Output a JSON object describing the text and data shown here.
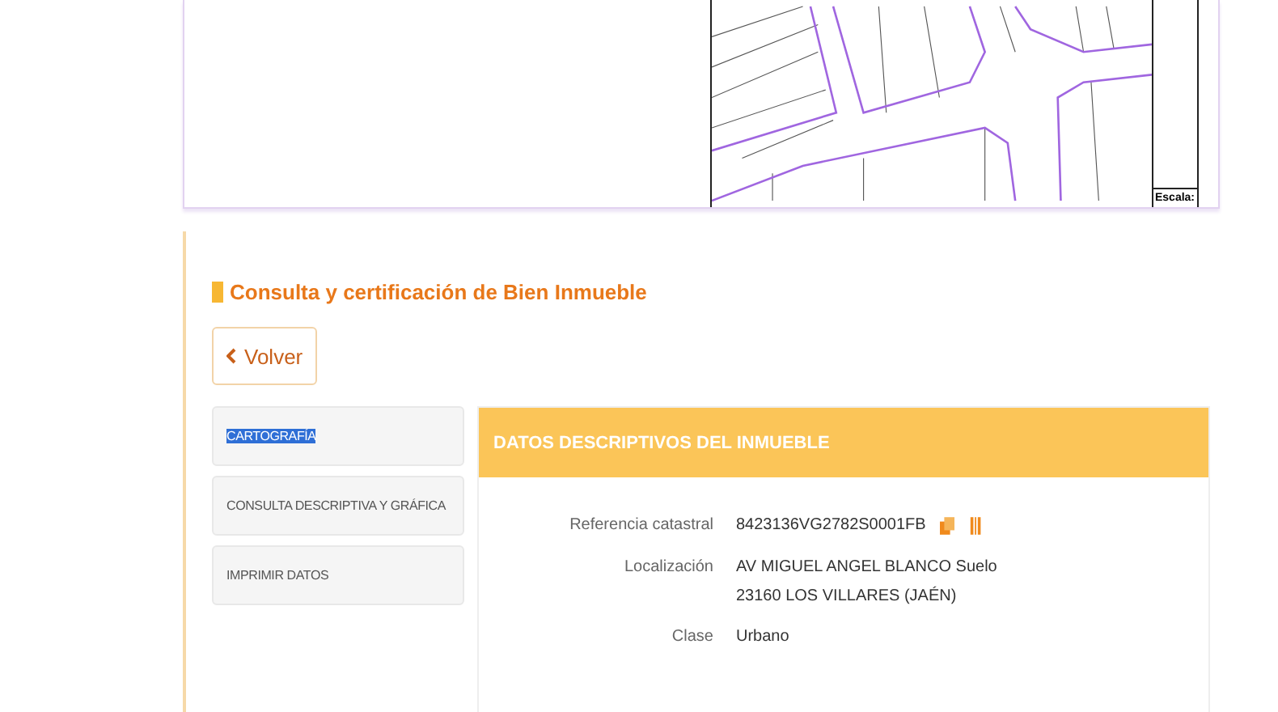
{
  "map": {
    "scale_label": "Escala:"
  },
  "page": {
    "title": "Consulta y certificación de Bien Inmueble",
    "back_button": "Volver"
  },
  "sidebar": {
    "items": [
      {
        "label": "CARTOGRAFÍA",
        "selected": true
      },
      {
        "label": "CONSULTA DESCRIPTIVA Y GRÁFICA",
        "selected": false
      },
      {
        "label": "IMPRIMIR DATOS",
        "selected": false
      }
    ]
  },
  "panel": {
    "title": "DATOS DESCRIPTIVOS DEL INMUEBLE",
    "fields": [
      {
        "label": "Referencia catastral",
        "lines": [
          "8423136VG2782S0001FB"
        ],
        "kind": "reference"
      },
      {
        "label": "Localización",
        "lines": [
          "AV MIGUEL ANGEL BLANCO Suelo",
          "23160 LOS VILLARES (JAÉN)"
        ],
        "kind": "text"
      },
      {
        "label": "Clase",
        "lines": [
          "Urbano"
        ],
        "kind": "text"
      }
    ]
  }
}
